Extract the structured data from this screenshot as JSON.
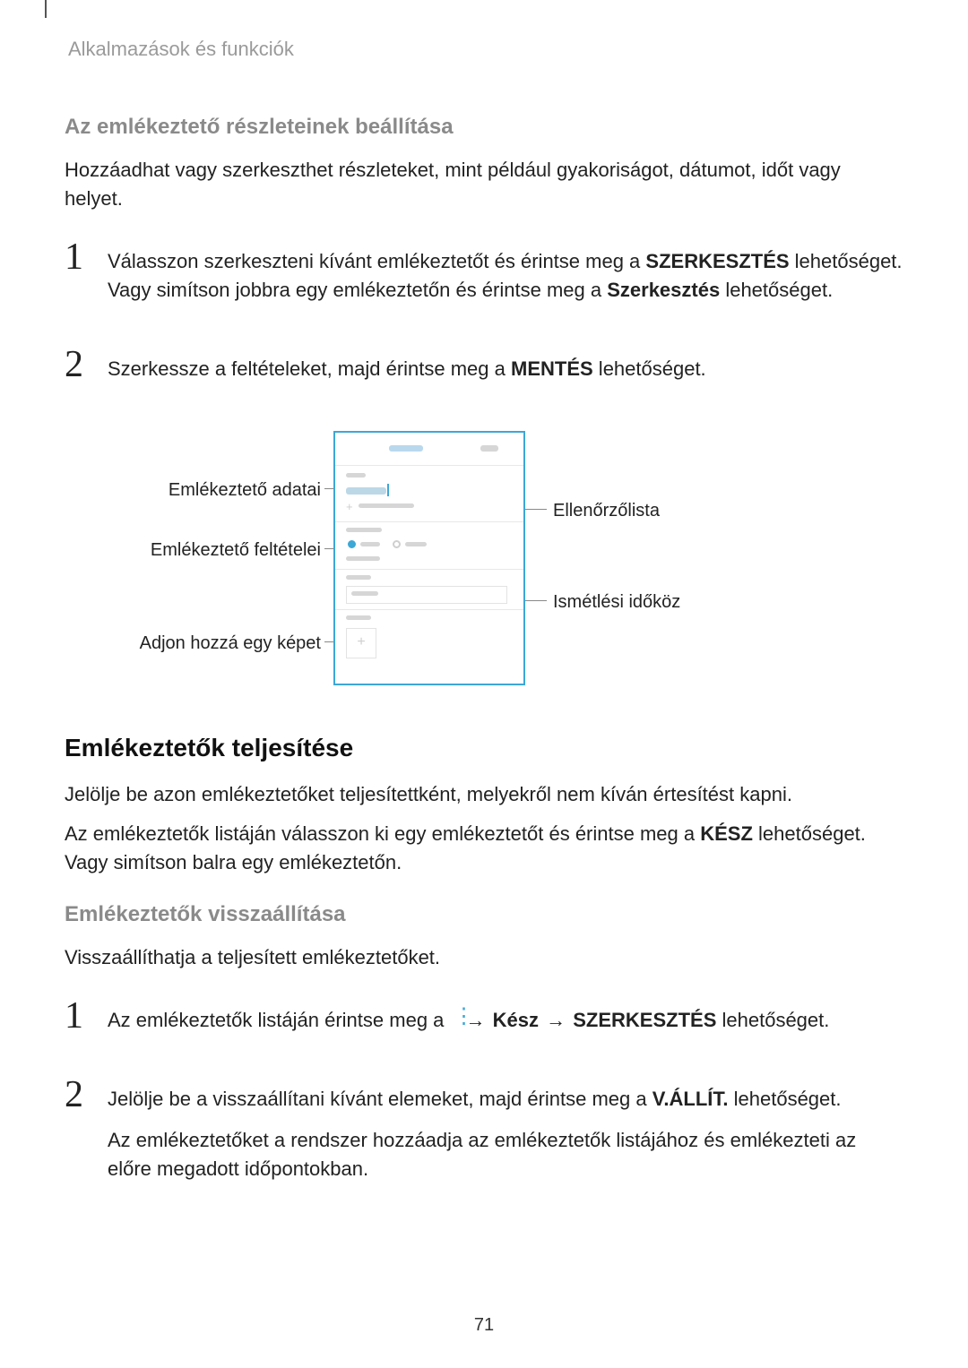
{
  "header": {
    "running": "Alkalmazások és funkciók"
  },
  "sec1": {
    "title": "Az emlékeztető részleteinek beállítása",
    "intro": "Hozzáadhat vagy szerkeszthet részleteket, mint például gyakoriságot, dátumot, időt vagy helyet.",
    "step1a": "Válasszon szerkeszteni kívánt emlékeztetőt és érintse meg a ",
    "step1b": " lehetőséget. Vagy simítson jobbra egy emlékeztetőn és érintse meg a ",
    "step1c": " lehetőséget.",
    "step1_bold1": "SZERKESZTÉS",
    "step1_bold2": "Szerkesztés",
    "step2a": "Szerkessze a feltételeket, majd érintse meg a ",
    "step2b": " lehetőséget.",
    "step2_bold": "MENTÉS"
  },
  "diagram": {
    "left1": "Emlékeztető adatai",
    "left2": "Emlékeztető feltételei",
    "left3": "Adjon hozzá egy képet",
    "right1": "Ellenőrzőlista",
    "right2": "Ismétlési időköz"
  },
  "sec2": {
    "title": "Emlékeztetők teljesítése",
    "p1": "Jelölje be azon emlékeztetőket teljesítettként, melyekről nem kíván értesítést kapni.",
    "p2a": "Az emlékeztetők listáján válasszon ki egy emlékeztetőt és érintse meg a ",
    "p2b": " lehetőséget. Vagy simítson balra egy emlékeztetőn.",
    "p2_bold": "KÉSZ"
  },
  "sec3": {
    "title": "Emlékeztetők visszaállítása",
    "intro": "Visszaállíthatja a teljesített emlékeztetőket.",
    "step1a": "Az emlékeztetők listáján érintse meg a ",
    "step1b": " lehetőséget.",
    "step1_bold1": "Kész",
    "step1_bold2": "SZERKESZTÉS",
    "arrow": "→",
    "step2a": "Jelölje be a visszaállítani kívánt elemeket, majd érintse meg a ",
    "step2b": " lehetőséget.",
    "step2_bold": "V.ÁLLÍT.",
    "step2_p2": "Az emlékeztetőket a rendszer hozzáadja az emlékeztetők listájához és emlékezteti az előre megadott időpontokban."
  },
  "pagenum": "71",
  "nums": {
    "one": "1",
    "two": "2"
  }
}
